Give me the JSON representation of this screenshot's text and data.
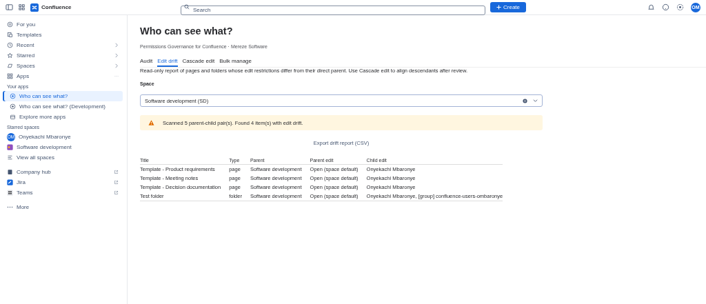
{
  "topbar": {
    "product": "Confluence",
    "search": {
      "placeholder": "Search"
    },
    "create": "Create",
    "avatar": "OM"
  },
  "sidebar": {
    "items": [
      {
        "label": "For you",
        "kind": "home",
        "chevron": false,
        "more": false
      },
      {
        "label": "Templates",
        "kind": "template",
        "chevron": false,
        "more": false
      },
      {
        "label": "Recent",
        "kind": "clock",
        "chevron": true,
        "more": false
      },
      {
        "label": "Starred",
        "kind": "star",
        "chevron": true,
        "more": false
      },
      {
        "label": "Spaces",
        "kind": "spaces",
        "chevron": true,
        "more": false
      },
      {
        "label": "Apps",
        "kind": "apps",
        "chevron": false,
        "more": true
      }
    ],
    "apps_heading": "Your apps",
    "apps": [
      {
        "label": "Who can see what?",
        "kind": "app",
        "selected": true
      },
      {
        "label": "Who can see what? (Development)",
        "kind": "app",
        "selected": false
      },
      {
        "label": "Explore more apps",
        "kind": "store",
        "selected": false
      }
    ],
    "spaces_heading": "Starred spaces",
    "spaces": [
      {
        "label": "Onyekachi Mbaronye",
        "kind": "avatar",
        "initials": "OM"
      },
      {
        "label": "Software development",
        "kind": "space"
      },
      {
        "label": "View all spaces",
        "kind": "list"
      }
    ],
    "links": [
      {
        "label": "Company hub",
        "kind": "hub"
      },
      {
        "label": "Jira",
        "kind": "jira"
      },
      {
        "label": "Teams",
        "kind": "teams"
      }
    ],
    "more": "More"
  },
  "main": {
    "title": "Who can see what?",
    "subtitle": "Permissions Governance for Confluence · Mereze Software",
    "tabs": [
      {
        "label": "Audit",
        "selected": false
      },
      {
        "label": "Edit drift",
        "selected": true
      },
      {
        "label": "Cascade edit",
        "selected": false
      },
      {
        "label": "Bulk manage",
        "selected": false
      }
    ],
    "description": "Read-only report of pages and folders whose edit restrictions differ from their direct parent. Use Cascade edit to align descendants after review.",
    "space_label": "Space",
    "space_value": "Software development (SD)",
    "alert": "Scanned 5 parent-child pair(s). Found 4 item(s) with edit drift.",
    "export": "Export drift report (CSV)",
    "table": {
      "columns": [
        "Title",
        "Type",
        "Parent",
        "Parent edit",
        "Child edit"
      ],
      "rows": [
        [
          "Template - Product requirements",
          "page",
          "Software development",
          "Open (space default)",
          "Onyekachi Mbaronye"
        ],
        [
          "Template - Meeting notes",
          "page",
          "Software development",
          "Open (space default)",
          "Onyekachi Mbaronye"
        ],
        [
          "Template - Decision documentation",
          "page",
          "Software development",
          "Open (space default)",
          "Onyekachi Mbaronye"
        ],
        [
          "Test folder",
          "folder",
          "Software development",
          "Open (space default)",
          "Onyekachi Mbaronye, [group] confluence-users-ombaronye"
        ]
      ]
    }
  }
}
